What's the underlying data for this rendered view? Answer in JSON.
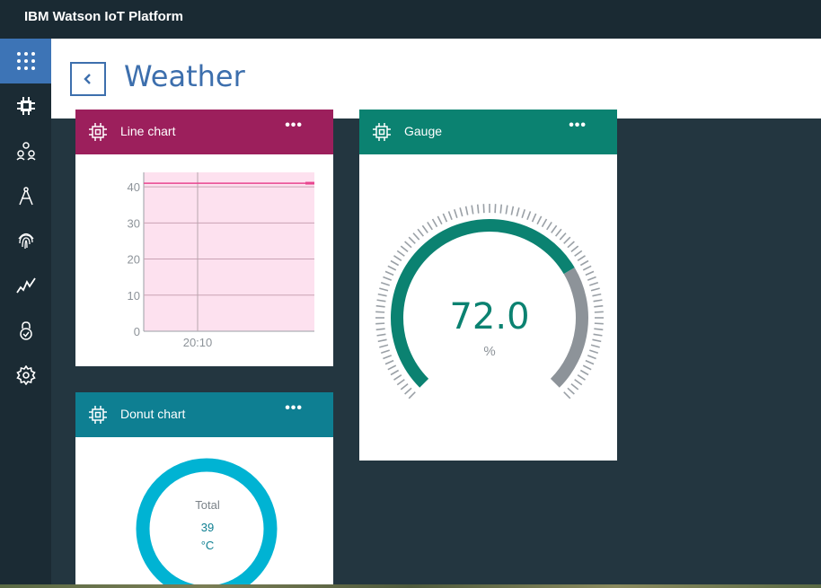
{
  "app": {
    "title": "IBM Watson IoT Platform"
  },
  "sidebar": {
    "items": [
      {
        "icon": "apps-grid-icon",
        "active": true
      },
      {
        "icon": "chip-icon"
      },
      {
        "icon": "members-icon"
      },
      {
        "icon": "compass-icon"
      },
      {
        "icon": "fingerprint-icon"
      },
      {
        "icon": "analytics-icon"
      },
      {
        "icon": "lock-icon"
      },
      {
        "icon": "gear-icon"
      }
    ]
  },
  "header": {
    "title": "Weather"
  },
  "cards": {
    "line_chart": {
      "title": "Line chart",
      "menu": "•••",
      "color": "#9c1f5c"
    },
    "gauge": {
      "title": "Gauge",
      "menu": "•••",
      "color": "#0b8271",
      "value": "72.0",
      "unit": "%"
    },
    "donut": {
      "title": "Donut chart",
      "menu": "•••",
      "color": "#0e7f92",
      "total_label": "Total",
      "total_value": "39",
      "unit": "°C"
    }
  },
  "chart_data": [
    {
      "type": "line",
      "title": "Line chart",
      "x": [
        "20:10"
      ],
      "series": [
        {
          "values": [
            41
          ]
        }
      ],
      "yticks": [
        0,
        10,
        20,
        30,
        40
      ],
      "ylim": [
        0,
        44
      ],
      "grid": true,
      "colors": {
        "line": "#e8458f",
        "fill": "#fde1ef"
      }
    },
    {
      "type": "gauge",
      "value": 72.0,
      "unit": "%",
      "min": 0,
      "max": 100,
      "colors": {
        "value": "#0b8271",
        "rest": "#8d9399"
      }
    },
    {
      "type": "pie",
      "values": [
        39
      ],
      "total": 39,
      "unit": "°C",
      "colors": {
        "ring": "#00b3d3"
      }
    }
  ]
}
